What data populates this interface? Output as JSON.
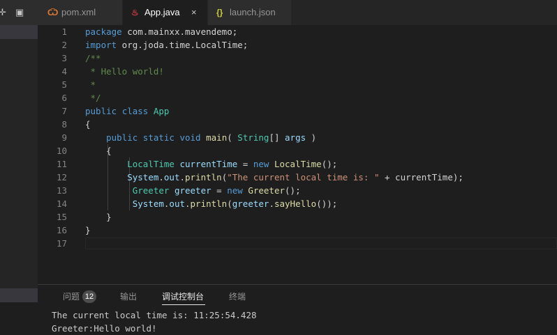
{
  "tabs": [
    {
      "label": "pom.xml",
      "icon": "rss-icon",
      "icon_glyph": "Ѿ",
      "icon_color": "#e37933",
      "active": false
    },
    {
      "label": "App.java",
      "icon": "java-icon",
      "icon_glyph": "♨",
      "icon_color": "#cc3e44",
      "active": true,
      "close_glyph": "×"
    },
    {
      "label": "launch.json",
      "icon": "json-icon",
      "icon_glyph": "{}",
      "icon_color": "#cbcb41",
      "active": false
    }
  ],
  "sidebar": {
    "icons": [
      {
        "name": "collapse-icon",
        "glyph": "✛"
      },
      {
        "name": "terminal-icon",
        "glyph": "▣"
      }
    ]
  },
  "editor": {
    "current_line": 17,
    "lines": [
      {
        "n": "1",
        "tokens": [
          [
            "kw",
            "package"
          ],
          [
            "pl",
            " com.mainxx.mavendemo;"
          ]
        ]
      },
      {
        "n": "2",
        "tokens": [
          [
            "kw",
            "import"
          ],
          [
            "pl",
            " org.joda.time.LocalTime;"
          ]
        ]
      },
      {
        "n": "3",
        "tokens": [
          [
            "cm",
            "/**"
          ]
        ]
      },
      {
        "n": "4",
        "tokens": [
          [
            "cm",
            " * Hello world!"
          ]
        ]
      },
      {
        "n": "5",
        "tokens": [
          [
            "cm",
            " *"
          ]
        ]
      },
      {
        "n": "6",
        "tokens": [
          [
            "cm",
            " */"
          ]
        ]
      },
      {
        "n": "7",
        "tokens": [
          [
            "kw",
            "public"
          ],
          [
            "pl",
            " "
          ],
          [
            "kw",
            "class"
          ],
          [
            "pl",
            " "
          ],
          [
            "ty",
            "App"
          ]
        ]
      },
      {
        "n": "8",
        "tokens": [
          [
            "pl",
            "{"
          ]
        ]
      },
      {
        "n": "9",
        "tokens": [
          [
            "pl",
            "    "
          ],
          [
            "kw",
            "public"
          ],
          [
            "pl",
            " "
          ],
          [
            "kw",
            "static"
          ],
          [
            "pl",
            " "
          ],
          [
            "kw",
            "void"
          ],
          [
            "pl",
            " "
          ],
          [
            "fn",
            "main"
          ],
          [
            "pl",
            "( "
          ],
          [
            "ty",
            "String"
          ],
          [
            "pl",
            "[] "
          ],
          [
            "vr",
            "args"
          ],
          [
            "pl",
            " )"
          ]
        ]
      },
      {
        "n": "10",
        "tokens": [
          [
            "pl",
            "    {"
          ]
        ]
      },
      {
        "n": "11",
        "tokens": [
          [
            "pl",
            "        "
          ],
          [
            "ty",
            "LocalTime"
          ],
          [
            "pl",
            " "
          ],
          [
            "vr",
            "currentTime"
          ],
          [
            "pl",
            " = "
          ],
          [
            "kw",
            "new"
          ],
          [
            "pl",
            " "
          ],
          [
            "fn",
            "LocalTime"
          ],
          [
            "pl",
            "();"
          ]
        ]
      },
      {
        "n": "12",
        "tokens": [
          [
            "pl",
            "        "
          ],
          [
            "vr",
            "System"
          ],
          [
            "pl",
            "."
          ],
          [
            "vr",
            "out"
          ],
          [
            "pl",
            "."
          ],
          [
            "fn",
            "println"
          ],
          [
            "pl",
            "("
          ],
          [
            "st",
            "\"The current local time is: \""
          ],
          [
            "pl",
            " + currentTime);"
          ]
        ]
      },
      {
        "n": "13",
        "tokens": [
          [
            "pl",
            "         "
          ],
          [
            "ty",
            "Greeter"
          ],
          [
            "pl",
            " "
          ],
          [
            "vr",
            "greeter"
          ],
          [
            "pl",
            " = "
          ],
          [
            "kw",
            "new"
          ],
          [
            "pl",
            " "
          ],
          [
            "fn",
            "Greeter"
          ],
          [
            "pl",
            "();"
          ]
        ]
      },
      {
        "n": "14",
        "tokens": [
          [
            "pl",
            "         "
          ],
          [
            "vr",
            "System"
          ],
          [
            "pl",
            "."
          ],
          [
            "vr",
            "out"
          ],
          [
            "pl",
            "."
          ],
          [
            "fn",
            "println"
          ],
          [
            "pl",
            "("
          ],
          [
            "vr",
            "greeter"
          ],
          [
            "pl",
            "."
          ],
          [
            "fn",
            "sayHello"
          ],
          [
            "pl",
            "());"
          ]
        ]
      },
      {
        "n": "15",
        "tokens": [
          [
            "pl",
            "    }"
          ]
        ]
      },
      {
        "n": "16",
        "tokens": [
          [
            "pl",
            "}"
          ]
        ]
      },
      {
        "n": "17",
        "tokens": []
      }
    ]
  },
  "panel": {
    "tabs": [
      {
        "label": "问题",
        "badge": "12",
        "active": false
      },
      {
        "label": "输出",
        "active": false
      },
      {
        "label": "调试控制台",
        "active": true
      },
      {
        "label": "终端",
        "active": false
      }
    ],
    "output": [
      "The current local time is: 11:25:54.428",
      "Greeter:Hello world!"
    ]
  },
  "colors": {
    "editor_bg": "#1e1e1e",
    "tab_inactive_bg": "#2d2d2d",
    "keyword": "#569cd6",
    "comment": "#608b4e",
    "type": "#4ec9b0",
    "function": "#dcdcaa",
    "string": "#ce9178",
    "variable": "#9cdcfe"
  }
}
